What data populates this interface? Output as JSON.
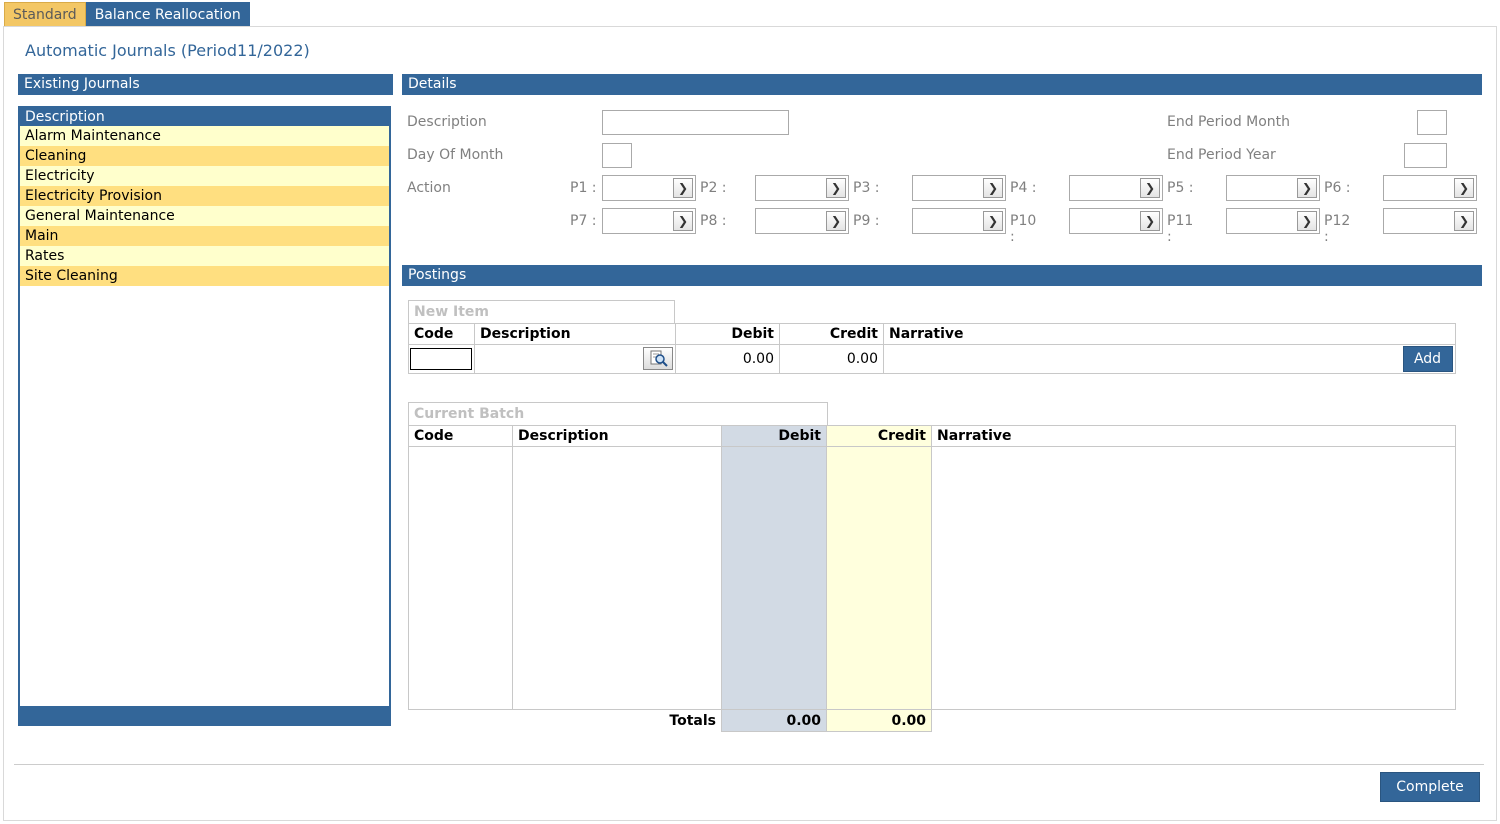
{
  "tabs": [
    {
      "label": "Standard"
    },
    {
      "label": "Balance Reallocation"
    }
  ],
  "page_title": "Automatic Journals (Period11/2022)",
  "existing_journals": {
    "title": "Existing Journals",
    "column_header": "Description",
    "items": [
      "Alarm Maintenance",
      "Cleaning",
      "Electricity",
      "Electricity Provision",
      "General Maintenance",
      "Main",
      "Rates",
      "Site Cleaning"
    ]
  },
  "details": {
    "title": "Details",
    "description_label": "Description",
    "description_value": "",
    "day_of_month_label": "Day Of Month",
    "day_of_month_value": "",
    "end_period_month_label": "End Period Month",
    "end_period_year_label": "End Period Year",
    "action_label": "Action",
    "periods": [
      "P1 :",
      "P2 :",
      "P3 :",
      "P4 :",
      "P5 :",
      "P6 :",
      "P7 :",
      "P8 :",
      "P9 :",
      "P10 :",
      "P11 :",
      "P12 :"
    ]
  },
  "postings": {
    "title": "Postings",
    "new_item": {
      "caption": "New Item",
      "headers": {
        "code": "Code",
        "description": "Description",
        "debit": "Debit",
        "credit": "Credit",
        "narrative": "Narrative"
      },
      "row": {
        "code": "",
        "debit": "0.00",
        "credit": "0.00",
        "narrative": ""
      },
      "add_label": "Add"
    },
    "current_batch": {
      "caption": "Current Batch",
      "headers": {
        "code": "Code",
        "description": "Description",
        "debit": "Debit",
        "credit": "Credit",
        "narrative": "Narrative"
      },
      "totals_label": "Totals",
      "total_debit": "0.00",
      "total_credit": "0.00"
    }
  },
  "complete_label": "Complete",
  "colors": {
    "brand": "#336699",
    "tab_active": "#f3c765",
    "row_odd": "#ffffcc",
    "row_even": "#ffdf80",
    "debit_col": "#d2dae4",
    "credit_col": "#ffffdd"
  },
  "icons": {
    "lookup": "magnifier-lookup-icon",
    "dropdown": "chevron-down-icon"
  }
}
